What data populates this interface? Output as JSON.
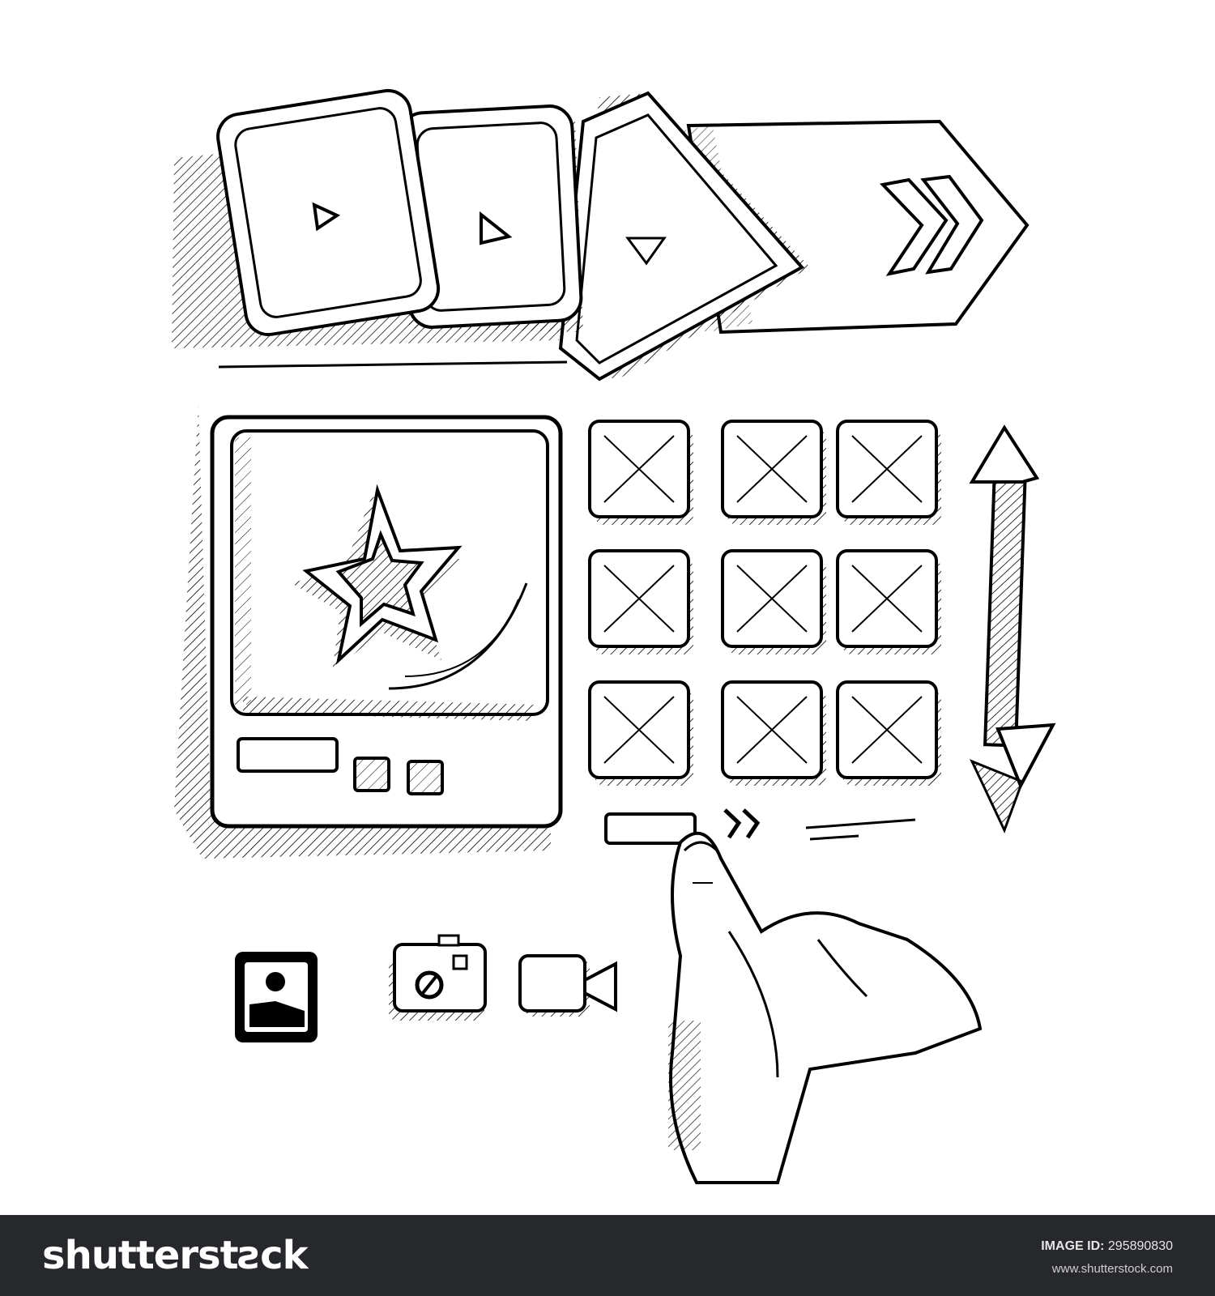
{
  "carousel": {
    "cards": [
      {
        "name": "video-card-1",
        "icon": "play-icon"
      },
      {
        "name": "video-card-2",
        "icon": "play-icon"
      },
      {
        "name": "video-card-3",
        "icon": "play-icon"
      }
    ],
    "next_icon": "double-chevron-right-icon"
  },
  "preview": {
    "image_icon": "star-icon",
    "controls": [
      "wide-button",
      "small-button",
      "small-button"
    ]
  },
  "grid": {
    "rows": 3,
    "cols": 3,
    "tile_icon": "image-placeholder-icon",
    "pager_icon": "double-chevron-right-icon"
  },
  "scroll_icon": "vertical-double-arrow-icon",
  "media_icons": [
    "photo-icon",
    "camera-icon",
    "video-camera-icon"
  ],
  "hand": "pointing-hand",
  "footer": {
    "logo": "shutterstƨck",
    "image_id_label": "IMAGE ID:",
    "image_id": "295890830",
    "site": "www.shutterstock.com"
  }
}
